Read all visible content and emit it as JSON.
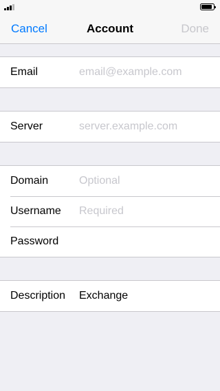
{
  "status_bar": {
    "signal_icon": "cellular-signal-icon",
    "battery_icon": "battery-icon"
  },
  "nav": {
    "cancel_label": "Cancel",
    "title": "Account",
    "done_label": "Done",
    "accent_color": "#007aff",
    "disabled_color": "#c7c7cc"
  },
  "form": {
    "email": {
      "label": "Email",
      "value": "",
      "placeholder": "email@example.com"
    },
    "server": {
      "label": "Server",
      "value": "",
      "placeholder": "server.example.com"
    },
    "domain": {
      "label": "Domain",
      "value": "",
      "placeholder": "Optional"
    },
    "username": {
      "label": "Username",
      "value": "",
      "placeholder": "Required"
    },
    "password": {
      "label": "Password",
      "value": "",
      "placeholder": ""
    },
    "description": {
      "label": "Description",
      "value": "Exchange",
      "placeholder": ""
    }
  }
}
